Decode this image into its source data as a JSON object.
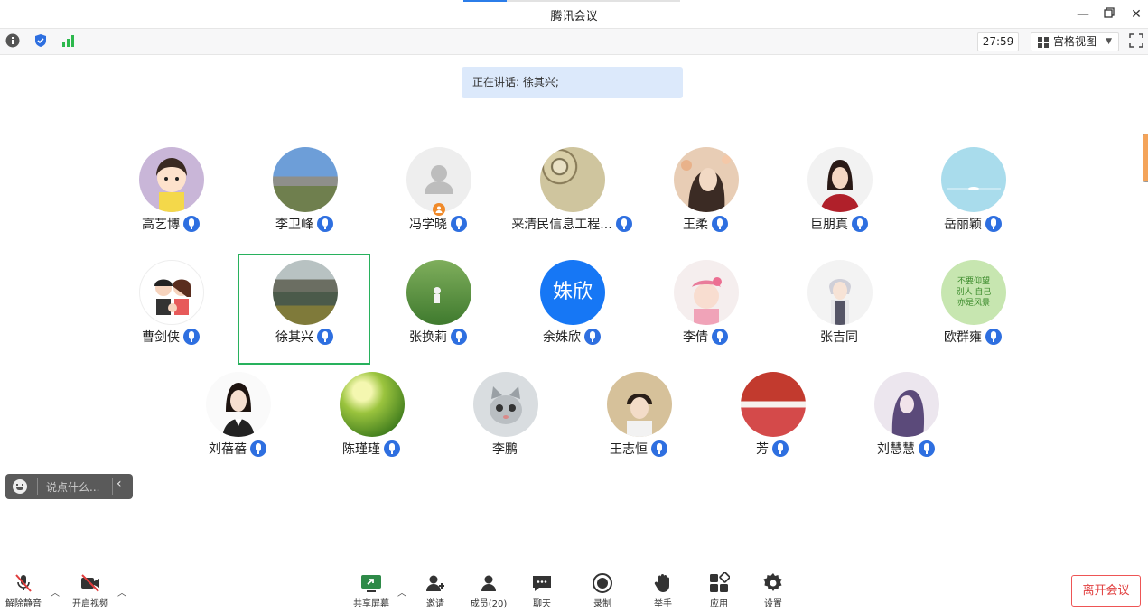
{
  "window": {
    "title": "腾讯会议"
  },
  "toolbar": {
    "timer": "27:59",
    "view_label": "宫格视图"
  },
  "banner": {
    "speaking": "正在讲话: 徐其兴;"
  },
  "participants": [
    {
      "name": "高艺博",
      "mic": true
    },
    {
      "name": "李卫峰",
      "mic": true
    },
    {
      "name": "冯学晓",
      "mic": true
    },
    {
      "name": "来清民信息工程...",
      "mic": true
    },
    {
      "name": "王柔",
      "mic": true
    },
    {
      "name": "巨朋真",
      "mic": true
    },
    {
      "name": "岳丽颖",
      "mic": true
    },
    {
      "name": "曹剑侠",
      "mic": true
    },
    {
      "name": "徐其兴",
      "mic": true
    },
    {
      "name": "张换莉",
      "mic": true
    },
    {
      "name": "余姝欣",
      "mic": true,
      "avatar_text": "姝欣"
    },
    {
      "name": "李倩",
      "mic": true
    },
    {
      "name": "张吉同",
      "mic": false
    },
    {
      "name": "欧群雍",
      "mic": true,
      "avatar_text": "不要仰望别人 自己亦是风景"
    },
    {
      "name": "刘蓓蓓",
      "mic": true
    },
    {
      "name": "陈瑾瑾",
      "mic": true
    },
    {
      "name": "李鹏",
      "mic": false
    },
    {
      "name": "王志恒",
      "mic": true
    },
    {
      "name": "芳",
      "mic": true
    },
    {
      "name": "刘慧慧",
      "mic": true
    }
  ],
  "chat": {
    "placeholder": "说点什么..."
  },
  "bottom": {
    "unmute": "解除静音",
    "start_video": "开启视频",
    "share": "共享屏幕",
    "invite": "邀请",
    "members": "成员(20)",
    "chat": "聊天",
    "record": "录制",
    "raise_hand": "举手",
    "apps": "应用",
    "settings": "设置",
    "leave": "离开会议"
  },
  "colors": {
    "accent": "#2e6fe0",
    "selected_border": "#28b15d",
    "leave": "#e03c3c",
    "banner": "#dce9fb"
  }
}
